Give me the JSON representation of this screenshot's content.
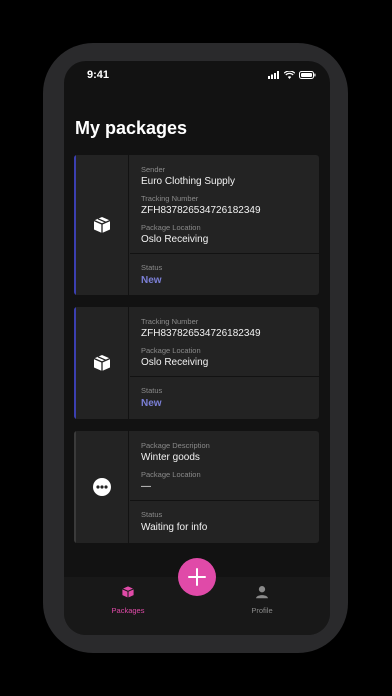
{
  "status_bar": {
    "time": "9:41"
  },
  "page": {
    "title": "My packages"
  },
  "colors": {
    "accent": "#e04aa8",
    "status_new": "#7b7fd6",
    "card_bar_active": "#3b3fb0",
    "card_bar_inactive": "#3a3a3a"
  },
  "cards": [
    {
      "icon": "box-icon",
      "fields": [
        {
          "label": "Sender",
          "value": "Euro Clothing Supply"
        },
        {
          "label": "Tracking Number",
          "value": "ZFH837826534726182349"
        },
        {
          "label": "Package Location",
          "value": "Oslo Receiving"
        }
      ],
      "status_label": "Status",
      "status_value": "New"
    },
    {
      "icon": "box-icon",
      "fields": [
        {
          "label": "Tracking Number",
          "value": "ZFH837826534726182349"
        },
        {
          "label": "Package Location",
          "value": "Oslo Receiving"
        }
      ],
      "status_label": "Status",
      "status_value": "New"
    },
    {
      "icon": "more-icon",
      "fields": [
        {
          "label": "Package Description",
          "value": "Winter goods"
        },
        {
          "label": "Package Location",
          "value": "—"
        }
      ],
      "status_label": "Status",
      "status_value": "Waiting for info"
    }
  ],
  "tabs": [
    {
      "label": "Packages",
      "icon": "box-icon",
      "active": true
    },
    {
      "label": "Profile",
      "icon": "person-icon",
      "active": false
    }
  ],
  "fab": {
    "icon": "plus-icon"
  }
}
